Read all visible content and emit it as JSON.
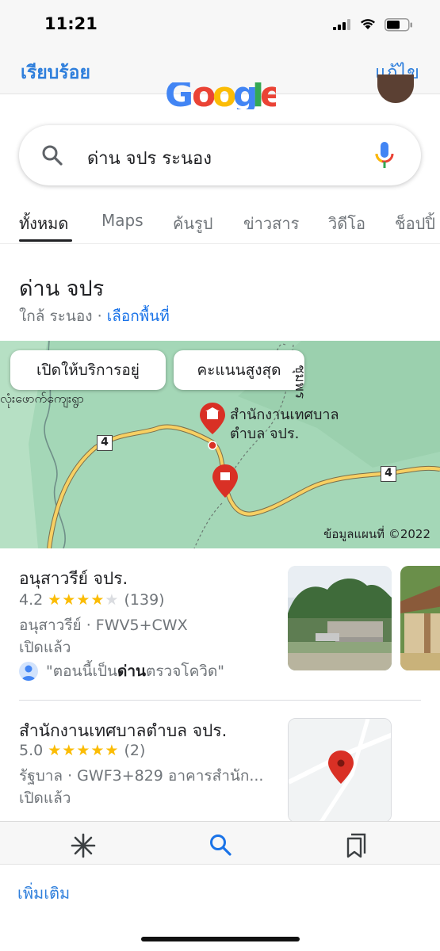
{
  "status_bar": {
    "time": "11:21"
  },
  "nav": {
    "done_label": "เรียบร้อย",
    "edit_label": "แก้ไข"
  },
  "search": {
    "query": "ด่าน จปร ระนอง"
  },
  "tabs": [
    {
      "label": "ทั้งหมด",
      "active": true
    },
    {
      "label": "Maps"
    },
    {
      "label": "ค้นรูป"
    },
    {
      "label": "ข่าวสาร"
    },
    {
      "label": "วิดีโอ"
    },
    {
      "label": "ช็อปปิ้"
    }
  ],
  "local": {
    "title": "ด่าน จปร",
    "near": "ใกล้ ระนอง",
    "separator": "·",
    "choose_area": "เลือกพื้นที่"
  },
  "map": {
    "chip_open": "เปิดให้บริการอยู่",
    "chip_top": "คะแนนสูงสุด",
    "label_myanmar": "လုံးဖောက်ကျေးရွာ",
    "label_office_line1": "สำนักงานเทศบาล",
    "label_office_line2": "ตำบล จปร.",
    "label_chumphon": "ชุมพร",
    "hwy_left": "4",
    "hwy_right": "4",
    "copyright": "ข้อมูลแผนที่ ©2022",
    "colors": {
      "land": "#a4d7b7",
      "road": "#f7d063",
      "pin": "#d93025"
    }
  },
  "results": [
    {
      "name": "อนุสาวรีย์ จปร.",
      "rating": "4.2",
      "stars_full": 4,
      "stars_text": "★★★★",
      "stars_empty_text": "★",
      "reviews": "(139)",
      "category_line": "อนุสาวรีย์ · FWV5+CWX",
      "status": "เปิดแล้ว",
      "review_prefix": "\"ตอนนี้เป็น",
      "review_bold": "ด่าน",
      "review_suffix": "ตรวจโควิด\""
    },
    {
      "name": "สำนักงานเทศบาลตำบล จปร.",
      "rating": "5.0",
      "stars_full": 5,
      "stars_text": "★★★★★",
      "reviews": "(2)",
      "category_line": "รัฐบาล · GWF3+829 อาคารสำนัก...",
      "status": "เปิดแล้ว"
    }
  ],
  "toolbar": {
    "icons": [
      "asterisk-icon",
      "search-icon",
      "bookmarks-icon"
    ]
  },
  "more": {
    "label": "เพิ่มเติม"
  }
}
